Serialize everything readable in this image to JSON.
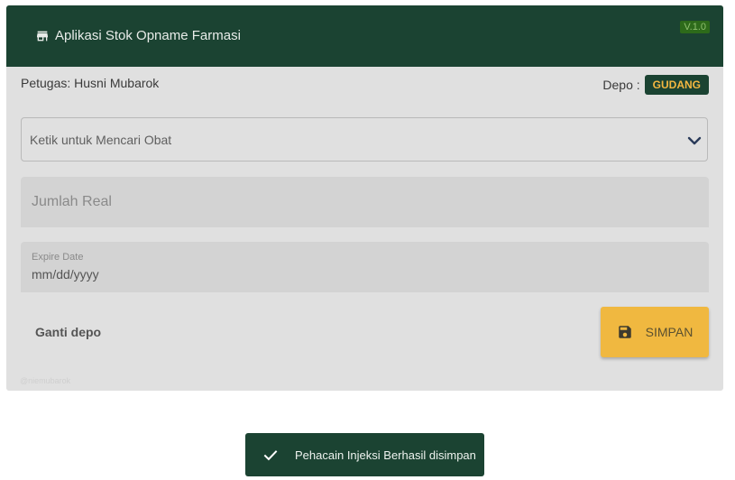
{
  "header": {
    "title": "Aplikasi Stok Opname Farmasi",
    "version": "V.1.0",
    "icon": "store-icon"
  },
  "info": {
    "petugas": "Petugas: Husni Mubarok",
    "depo_label": "Depo :",
    "depo_value": "GUDANG"
  },
  "form": {
    "search_placeholder": "Ketik untuk Mencari Obat",
    "jumlah_placeholder": "Jumlah Real",
    "expire_label": "Expire Date",
    "expire_value": "mm/dd/yyyy"
  },
  "actions": {
    "ganti_depo": "Ganti depo",
    "simpan": "SIMPAN"
  },
  "footer": {
    "credit": "@niemubarok"
  },
  "toast": {
    "message": "Pehacain Injeksi Berhasil disimpan"
  },
  "colors": {
    "primary": "#1b4332",
    "accent": "#f0b840",
    "badge_text": "#f4b740",
    "card_bg": "#e0e0e0"
  }
}
